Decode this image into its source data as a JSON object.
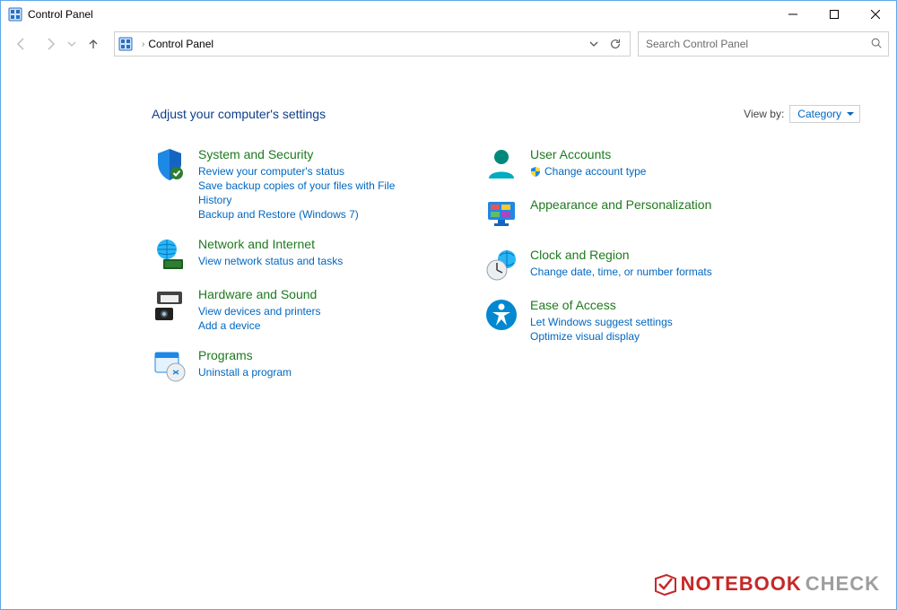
{
  "window": {
    "title": "Control Panel"
  },
  "address": {
    "root_label": "Control Panel"
  },
  "search": {
    "placeholder": "Search Control Panel"
  },
  "heading": "Adjust your computer's settings",
  "viewby": {
    "label": "View by:",
    "value": "Category"
  },
  "left": [
    {
      "title": "System and Security",
      "links": [
        "Review your computer's status",
        "Save backup copies of your files with File History",
        "Backup and Restore (Windows 7)"
      ]
    },
    {
      "title": "Network and Internet",
      "links": [
        "View network status and tasks"
      ]
    },
    {
      "title": "Hardware and Sound",
      "links": [
        "View devices and printers",
        "Add a device"
      ]
    },
    {
      "title": "Programs",
      "links": [
        "Uninstall a program"
      ]
    }
  ],
  "right": [
    {
      "title": "User Accounts",
      "links": [
        "Change account type"
      ],
      "uac_on_first_link": true
    },
    {
      "title": "Appearance and Personalization",
      "links": []
    },
    {
      "title": "Clock and Region",
      "links": [
        "Change date, time, or number formats"
      ]
    },
    {
      "title": "Ease of Access",
      "links": [
        "Let Windows suggest settings",
        "Optimize visual display"
      ]
    }
  ],
  "watermark": {
    "nb": "NOTEBOOK",
    "ck": "CHECK"
  }
}
